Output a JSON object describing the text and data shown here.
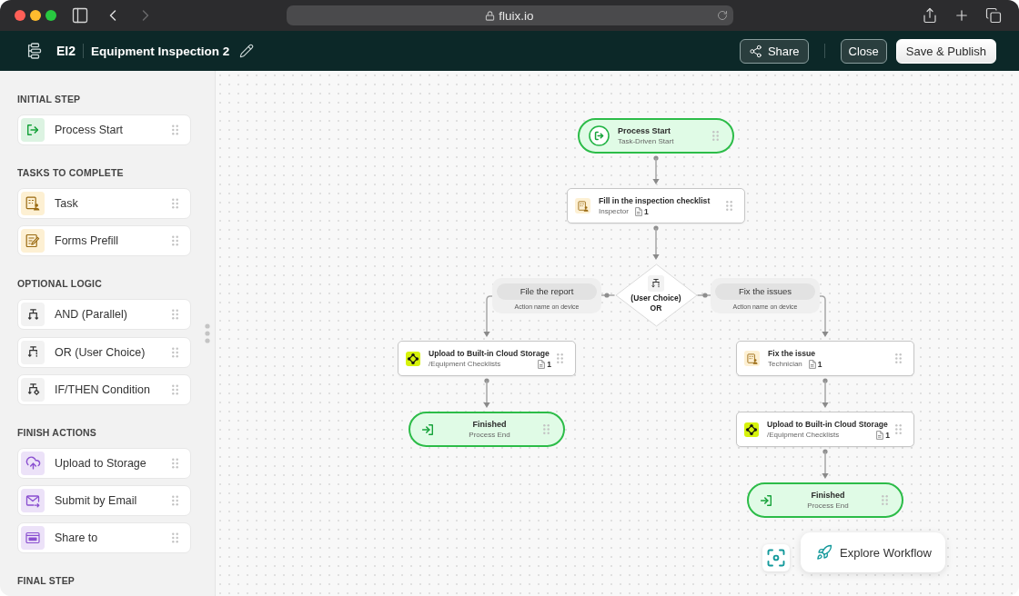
{
  "browser": {
    "nav": [
      {
        "kind": "back",
        "disabled": false
      },
      {
        "kind": "forward",
        "disabled": true
      }
    ],
    "url": "fluix.io"
  },
  "header": {
    "code": "EI2",
    "title": "Equipment Inspection 2",
    "actions": [
      {
        "kind": "share",
        "label": "Share"
      },
      {
        "kind": "close",
        "label": "Close"
      },
      {
        "kind": "publish",
        "label": "Save & Publish"
      }
    ]
  },
  "sidebar": {
    "sections": [
      {
        "title": "INITIAL STEP",
        "items": [
          {
            "kind": "start",
            "label": "Process Start"
          }
        ]
      },
      {
        "title": "TASKS TO COMPLETE",
        "items": [
          {
            "kind": "task",
            "label": "Task"
          },
          {
            "kind": "prefill",
            "label": "Forms Prefill"
          }
        ]
      },
      {
        "title": "OPTIONAL LOGIC",
        "items": [
          {
            "kind": "and",
            "label": "AND (Parallel)"
          },
          {
            "kind": "or",
            "label": "OR (User Choice)"
          },
          {
            "kind": "condition",
            "label": "IF/THEN Condition"
          }
        ]
      },
      {
        "title": "FINISH ACTIONS",
        "items": [
          {
            "kind": "storage",
            "label": "Upload to Storage"
          },
          {
            "kind": "email",
            "label": "Submit by Email"
          },
          {
            "kind": "share",
            "label": "Share to"
          }
        ]
      },
      {
        "title": "FINAL STEP"
      }
    ]
  },
  "canvas": {
    "flow": {
      "steps": [
        {
          "kind": "start",
          "title": "Process Start",
          "subtitle": "Task-Driven Start"
        },
        {
          "kind": "task",
          "title": "Fill in the inspection checklist",
          "subtitle": "Inspector",
          "count": "1"
        }
      ],
      "decision": {
        "kind": "or",
        "title": "(User Choice)",
        "label": "OR",
        "branches": [
          {
            "name": "File the report",
            "hint": "Action name on device",
            "steps": [
              {
                "kind": "upload",
                "title": "Upload to Built-in Cloud Storage",
                "subtitle": "/Equipment Checklists",
                "count": "1"
              },
              {
                "kind": "end",
                "title": "Finished",
                "subtitle": "Process End"
              }
            ]
          },
          {
            "name": "Fix the issues",
            "hint": "Action name on device",
            "steps": [
              {
                "kind": "task",
                "title": "Fix the issue",
                "subtitle": "Technician",
                "count": "1"
              },
              {
                "kind": "upload",
                "title": "Upload to Built-in Cloud Storage",
                "subtitle": "/Equipment Checklists",
                "count": "1"
              },
              {
                "kind": "end",
                "title": "Finished",
                "subtitle": "Process End"
              }
            ]
          }
        ]
      }
    },
    "explore_button": {
      "label": "Explore Workflow"
    }
  }
}
